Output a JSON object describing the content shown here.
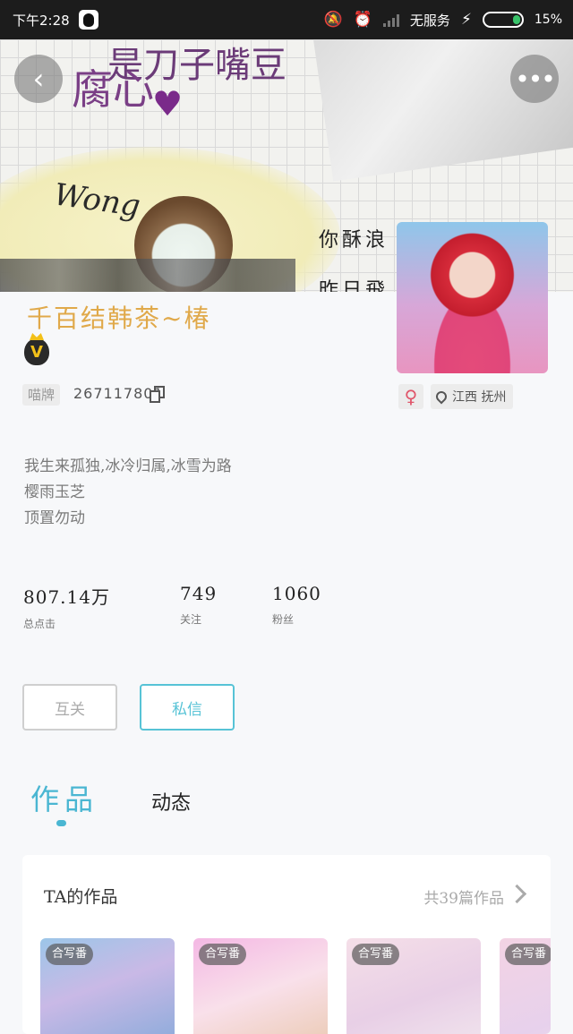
{
  "status_bar": {
    "time": "下午2:28",
    "carrier": "无服务",
    "battery": "15%"
  },
  "cover": {
    "text_top": "是刀子嘴豆",
    "text_main": "腐心",
    "signature": "Wong",
    "hand_line_1": "你酥浪",
    "hand_line_2": "昨日飛"
  },
  "profile": {
    "username": "千百结韩茶~椿",
    "vip_label": "V",
    "id_tag": "喵牌",
    "id_value": "267117801",
    "gender": "♀",
    "location": "江西 抚州",
    "bio": [
      "我生来孤独,冰冷归属,冰雪为路",
      "樱雨玉芝",
      "顶置勿动"
    ]
  },
  "stats": [
    {
      "value": "807.14万",
      "label": "总点击"
    },
    {
      "value": "749",
      "label": "关注"
    },
    {
      "value": "1060",
      "label": "粉丝"
    }
  ],
  "actions": {
    "mutual": "互关",
    "message": "私信"
  },
  "tabs": {
    "works": "作品",
    "activity": "动态"
  },
  "works_section": {
    "title": "TA的作品",
    "count": "共39篇作品",
    "badge": "合写番"
  },
  "colors": {
    "accent": "#4ab6d2",
    "username": "#e0a94a",
    "gender": "#e0556a"
  }
}
